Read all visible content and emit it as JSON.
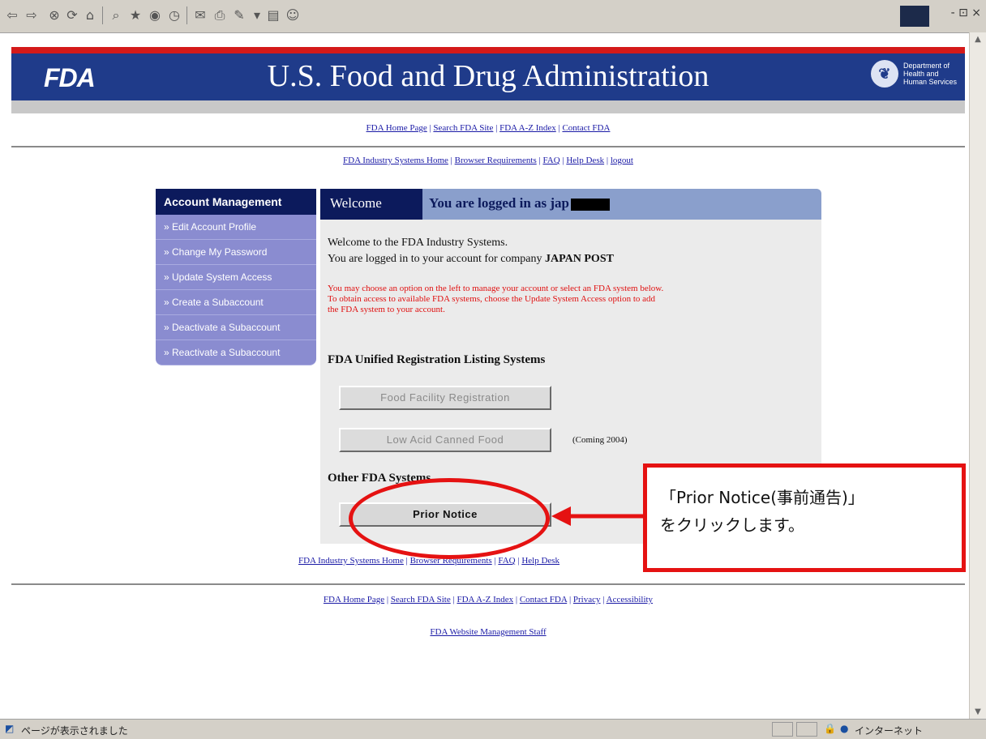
{
  "browser": {
    "window_controls": "- ⊡ ×",
    "status_text": "ページが表示されました",
    "zone_text": "インターネット"
  },
  "banner": {
    "logo_text": "FDA",
    "title": "U.S. Food and Drug Administration",
    "hhs_line1": "Department of",
    "hhs_line2": "Health and",
    "hhs_line3": "Human Services"
  },
  "top_links": [
    "FDA Home Page",
    "Search FDA Site",
    "FDA A-Z Index",
    "Contact FDA"
  ],
  "system_links": [
    "FDA Industry Systems Home",
    "Browser Requirements",
    "FAQ",
    "Help Desk",
    "logout"
  ],
  "nav": {
    "heading": "Account Management",
    "items": [
      "» Edit Account Profile",
      "» Change My Password",
      "» Update System Access",
      "» Create a Subaccount",
      "» Deactivate a Subaccount",
      "» Reactivate a Subaccount"
    ]
  },
  "panel": {
    "tab_welcome": "Welcome",
    "tab_logged_in": "You are logged in as jap",
    "welcome_line1": "Welcome to the FDA Industry Systems.",
    "welcome_line2_prefix": "You are logged in to your account for company",
    "company": "JAPAN POST",
    "notice_line1": "You may choose an option on the left to manage your account or select an FDA system below.",
    "notice_line2": "To obtain access to available FDA systems, choose the Update System Access option to add",
    "notice_line3": "the FDA system to your account.",
    "section1_heading": "FDA Unified Registration Listing Systems",
    "btn_food_facility": "Food Facility Registration",
    "btn_low_acid": "Low Acid Canned Food",
    "coming_note": "(Coming 2004)",
    "section2_heading": "Other FDA Systems",
    "btn_prior_notice": "Prior Notice"
  },
  "bottom_system_links": [
    "FDA Industry Systems Home",
    "Browser Requirements",
    "FAQ",
    "Help Desk"
  ],
  "footer_links": [
    "FDA Home Page",
    "Search FDA Site",
    "FDA A-Z Index",
    "Contact FDA",
    "Privacy",
    "Accessibility"
  ],
  "footer_staff": "FDA Website Management Staff",
  "annotation": {
    "line1": "「Prior Notice(事前通告)」",
    "line2": "をクリックします。"
  },
  "colors": {
    "annotation_red": "#e51212",
    "banner_blue": "#1f3b8a",
    "nav_purple": "#8a8cd0"
  }
}
